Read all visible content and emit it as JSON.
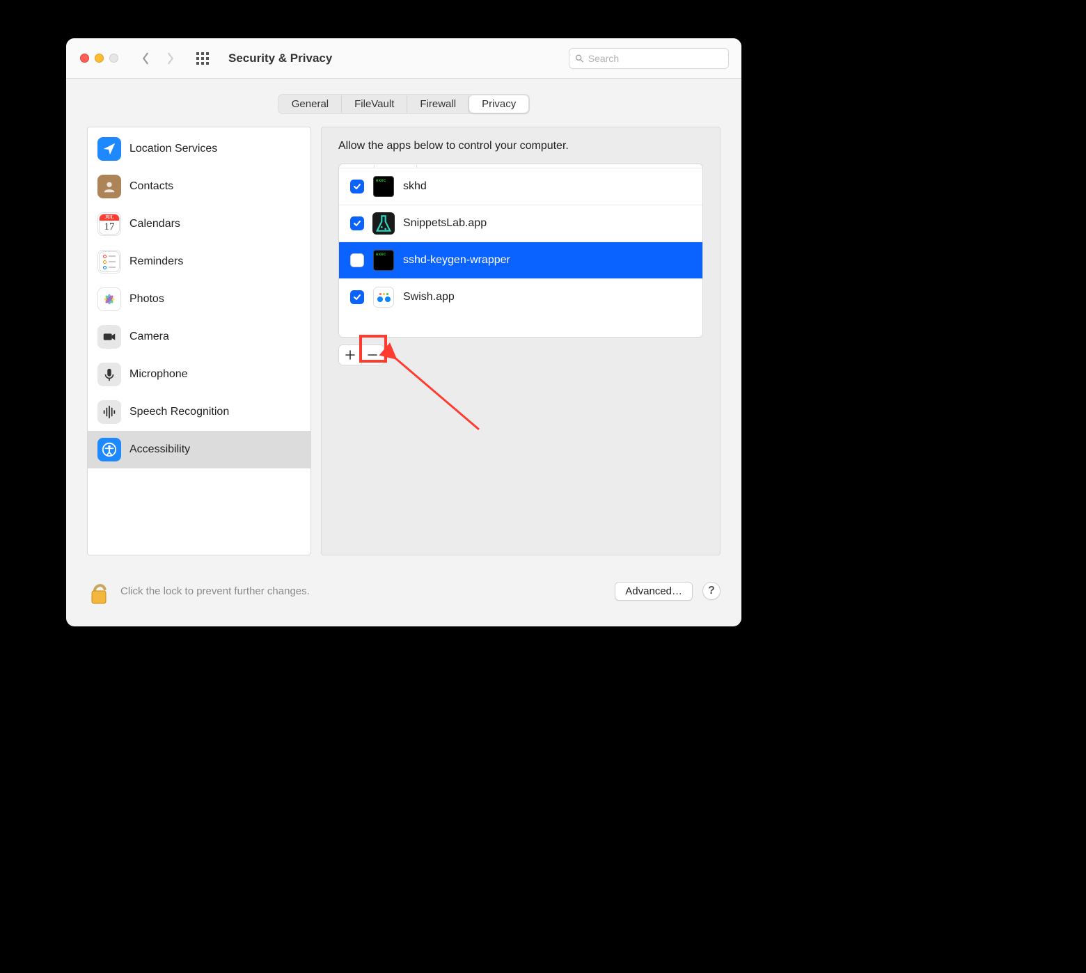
{
  "window": {
    "title": "Security & Privacy"
  },
  "search": {
    "placeholder": "Search"
  },
  "tabs": [
    "General",
    "FileVault",
    "Firewall",
    "Privacy"
  ],
  "active_tab_index": 3,
  "sidebar": {
    "items": [
      {
        "label": "Location Services",
        "icon": "location-arrow-icon",
        "bg": "#1e88ff"
      },
      {
        "label": "Contacts",
        "icon": "contacts-icon",
        "bg": "#ad8458"
      },
      {
        "label": "Calendars",
        "icon": "calendar-icon",
        "bg": "#ffffff"
      },
      {
        "label": "Reminders",
        "icon": "reminders-icon",
        "bg": "#ffffff"
      },
      {
        "label": "Photos",
        "icon": "photos-icon",
        "bg": "#ffffff"
      },
      {
        "label": "Camera",
        "icon": "camera-icon",
        "bg": "#e7e7e7"
      },
      {
        "label": "Microphone",
        "icon": "microphone-icon",
        "bg": "#e7e7e7"
      },
      {
        "label": "Speech Recognition",
        "icon": "waveform-icon",
        "bg": "#e7e7e7"
      },
      {
        "label": "Accessibility",
        "icon": "accessibility-icon",
        "bg": "#1e88ff"
      }
    ],
    "selected_index": 8
  },
  "right": {
    "heading": "Allow the apps below to control your computer.",
    "apps": [
      {
        "name": "skhd",
        "checked": true,
        "icon": "exec-icon",
        "selected": false
      },
      {
        "name": "SnippetsLab.app",
        "checked": true,
        "icon": "flask-icon",
        "selected": false
      },
      {
        "name": "sshd-keygen-wrapper",
        "checked": false,
        "icon": "exec-icon",
        "selected": true
      },
      {
        "name": "Swish.app",
        "checked": true,
        "icon": "swish-dots-icon",
        "selected": false
      }
    ]
  },
  "annotation": {
    "highlight_remove_button": true,
    "arrow_color": "#ff3b30"
  },
  "footer": {
    "lock_text": "Click the lock to prevent further changes.",
    "advanced_label": "Advanced…",
    "help_label": "?"
  }
}
